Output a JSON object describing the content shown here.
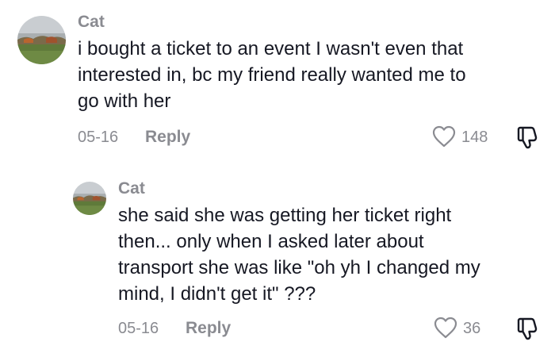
{
  "comments": [
    {
      "username": "Cat",
      "lines": [
        "i bought a ticket to an event I wasn't even that",
        "interested in, bc my friend really wanted me to",
        "go with her"
      ],
      "date": "05-16",
      "reply_label": "Reply",
      "like_count": "148",
      "icons": {
        "like": "heart-outline-icon",
        "dislike": "thumbs-down-icon"
      }
    },
    {
      "username": "Cat",
      "lines": [
        "she said she was getting her ticket right",
        "then... only when I asked later about",
        "transport she was like \"oh yh I changed my",
        "mind, I didn't get it\" ???"
      ],
      "date": "05-16",
      "reply_label": "Reply",
      "like_count": "36",
      "icons": {
        "like": "heart-outline-icon",
        "dislike": "thumbs-down-icon"
      }
    }
  ],
  "colors": {
    "text": "#161823",
    "muted": "#8a8b91"
  }
}
